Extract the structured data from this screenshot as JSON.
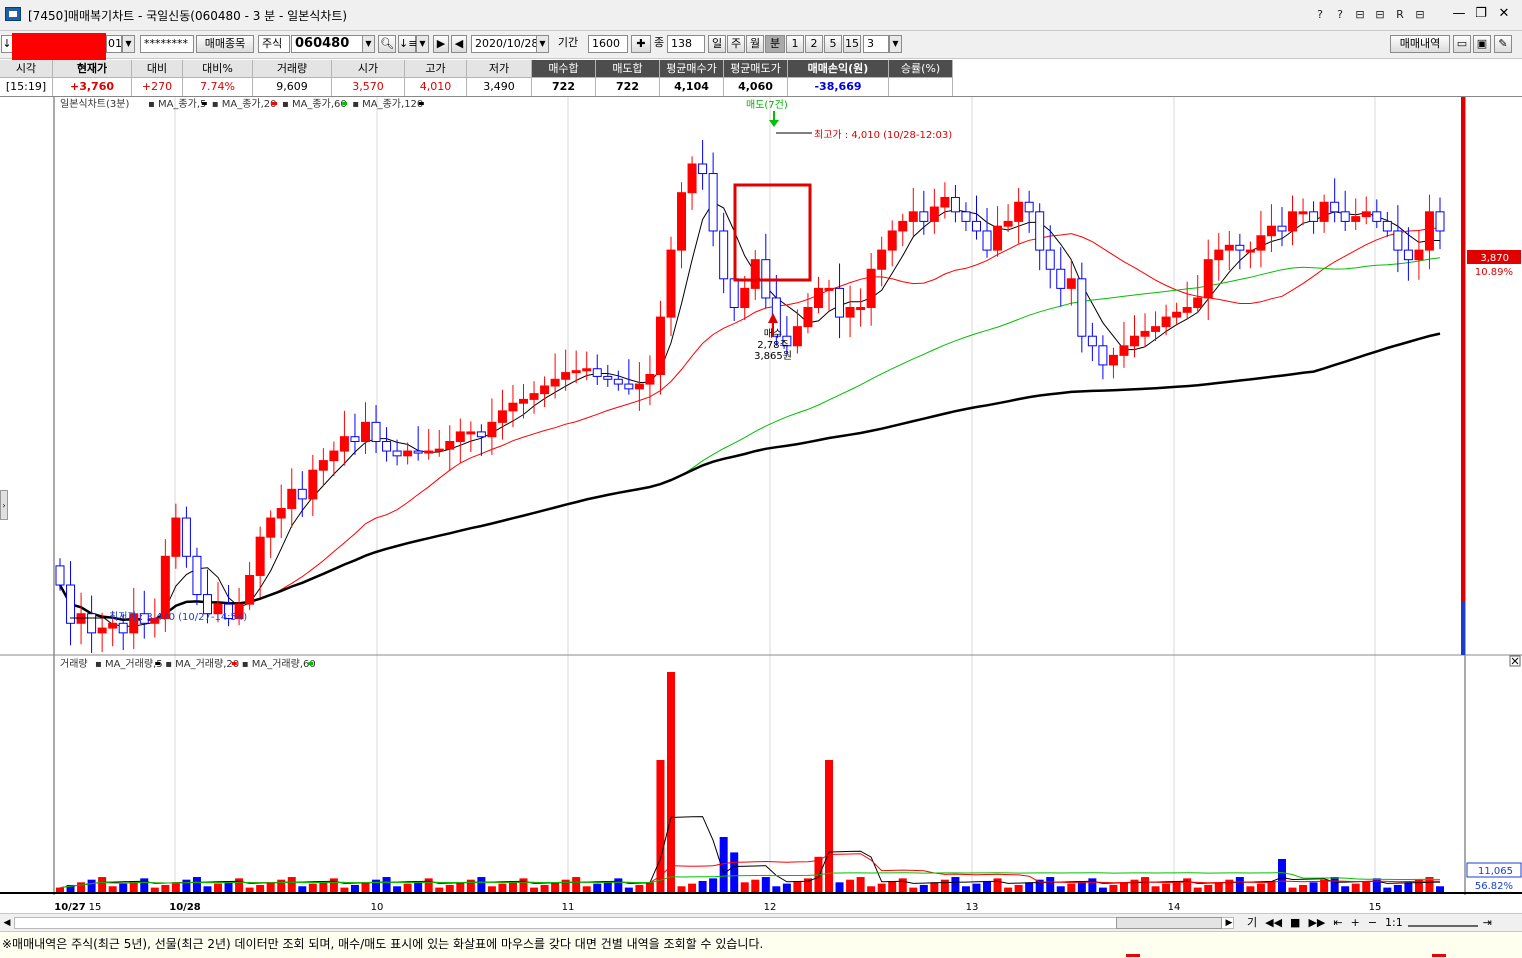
{
  "window": {
    "title": "[7450]매매복기차트 - 국일신동(060480 - 3 분 - 일본식차트)",
    "icons": [
      "?",
      "?",
      "⊟",
      "⊟",
      "R",
      "⊟"
    ],
    "minimize": "—",
    "restore": "❐",
    "close": "✕"
  },
  "toolbar": {
    "account_suffix": "01",
    "password": "********",
    "trade_symbol_button": "매매종목",
    "market_type": "주식",
    "stock_code": "060480",
    "date": "2020/10/28",
    "period_label": "기간",
    "period_value": "1600",
    "count_label": "종",
    "count_value": "138",
    "timeframes": [
      "일",
      "주",
      "월",
      "분",
      "1",
      "2",
      "5",
      "15",
      "3"
    ],
    "active_timeframe": "분",
    "history_button": "매매내역"
  },
  "info": {
    "headers": [
      "시각",
      "현재가",
      "대비",
      "대비%",
      "거래량",
      "시가",
      "고가",
      "저가",
      "매수합",
      "매도합",
      "평균매수가",
      "평균매도가",
      "매매손익(원)",
      "승률(%)"
    ],
    "values": [
      "[15:19]",
      "+3,760",
      "+270",
      "7.74%",
      "9,609",
      "3,570",
      "4,010",
      "3,490",
      "722",
      "722",
      "4,104",
      "4,060",
      "-38,669",
      ""
    ]
  },
  "chart_data": {
    "type": "candlestick",
    "price_panel_label": "일본식차트(3분)",
    "price_legend": [
      {
        "name": "MA_종가,5",
        "color": "#000000"
      },
      {
        "name": "MA_종가,20",
        "color": "#ff0000"
      },
      {
        "name": "MA_종가,60",
        "color": "#00c000"
      },
      {
        "name": "MA_종가,120",
        "color": "#000000"
      }
    ],
    "volume_panel_label": "거래량",
    "volume_legend": [
      {
        "name": "MA_거래량,5",
        "color": "#000000"
      },
      {
        "name": "MA_거래량,20",
        "color": "#ff0000"
      },
      {
        "name": "MA_거래량,60",
        "color": "#00c000"
      }
    ],
    "x_labels": [
      "10/27",
      "15",
      "10/28",
      "10",
      "11",
      "12",
      "13",
      "14",
      "15"
    ],
    "annotations": {
      "sell": "매도(7건)",
      "high": "최고가 : 4,010 (10/28-12:03)",
      "low": "최저가 : 3,470 (10/27-14:54)",
      "buy": [
        "매수",
        "2,78주",
        "3,865원"
      ]
    },
    "current_price_label": "3,870",
    "current_pct_label": "10.89%",
    "volume_value_label": "11,065",
    "volume_pct_label": "56.82%",
    "price_range": [
      3460,
      4040
    ]
  },
  "nav_controls": [
    "기",
    "◀◀",
    "■",
    "▶▶",
    "⇤",
    "+",
    "−",
    "1:1",
    "⇥"
  ],
  "status_message": "※매매내역은 주식(최근 5년), 선물(최근 2년) 데이터만 조회 되며, 매수/매도 표시에 있는 화살표에 마우스를 갖다 대면 건별 내역을 조회할 수 있습니다.",
  "colors": {
    "up": "#ff0000",
    "down": "#0000ff",
    "ma5": "#000000",
    "ma20": "#ff0000",
    "ma60": "#00c000",
    "ma120": "#000000",
    "sell_marker": "#00c000",
    "buy_marker": "#ff0000"
  }
}
